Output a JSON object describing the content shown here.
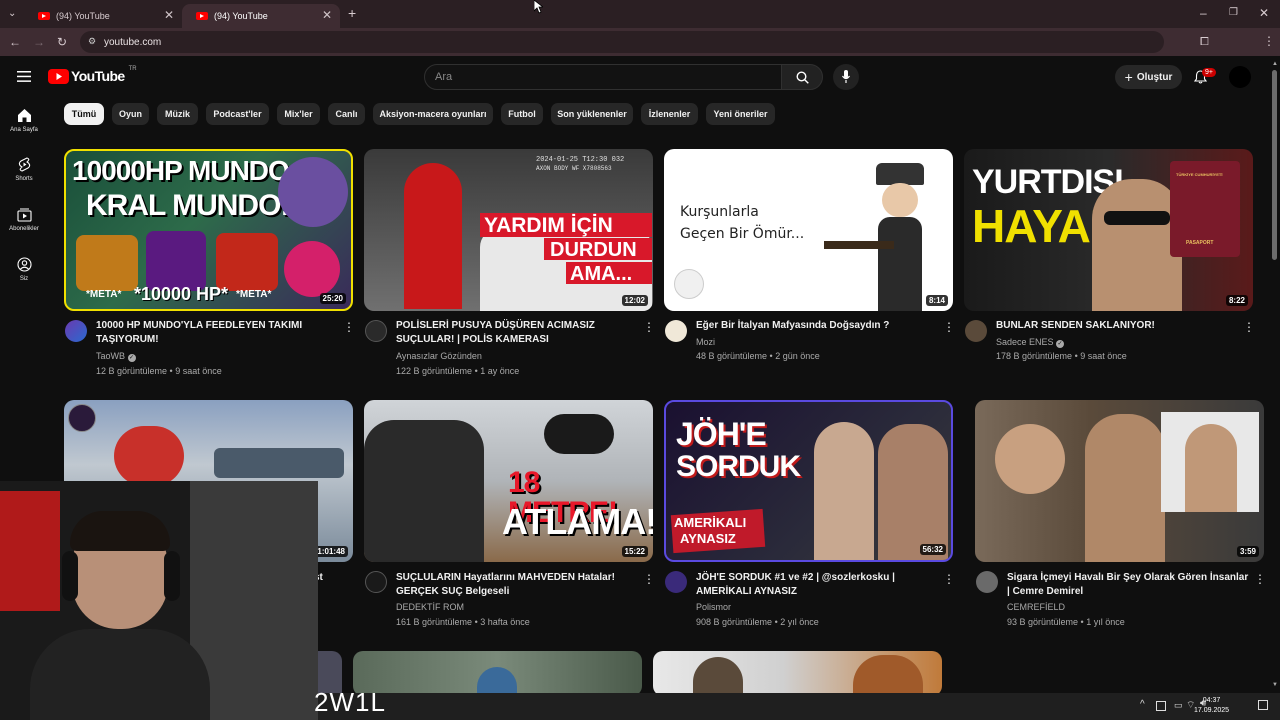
{
  "browser": {
    "tabs": [
      {
        "title": "(94) YouTube"
      },
      {
        "title": "(94) YouTube"
      }
    ],
    "new_tab": "+",
    "url": "youtube.com",
    "extension_badge": "19"
  },
  "masthead": {
    "logo_text": "YouTube",
    "logo_region": "TR",
    "search_placeholder": "Ara",
    "create_label": "Oluştur",
    "notifications_badge": "9+"
  },
  "sidebar": {
    "items": [
      {
        "label": "Ana Sayfa",
        "icon": "home-icon"
      },
      {
        "label": "Shorts",
        "icon": "shorts-icon"
      },
      {
        "label": "Abonelikler",
        "icon": "subscriptions-icon"
      },
      {
        "label": "Siz",
        "icon": "you-icon"
      }
    ]
  },
  "chips": [
    "Tümü",
    "Oyun",
    "Müzik",
    "Podcast'ler",
    "Mix'ler",
    "Canlı",
    "Aksiyon-macera oyunları",
    "Futbol",
    "Son yüklenenler",
    "İzlenenler",
    "Yeni öneriler"
  ],
  "videos": [
    {
      "title_line1": "10000 HP MUNDO'YLA FEEDLEYEN TAKIMI",
      "title_line2": "TAŞIYORUM!",
      "channel": "TaoWB",
      "verified": true,
      "views": "12 B görüntüleme",
      "age": "9 saat önce",
      "duration": "25:20",
      "thumb_text": [
        "10000HP MUNDO",
        "KRAL MUNDO!",
        "*META*",
        "*10000 HP*",
        "*META*"
      ]
    },
    {
      "title_line1": "POLİSLERİ PUSUYA DÜŞÜREN ACIMASIZ",
      "title_line2": "SUÇLULAR! | POLİS KAMERASI",
      "channel": "Aynasızlar Gözünden",
      "verified": false,
      "views": "122 B görüntüleme",
      "age": "1 ay önce",
      "duration": "12:02",
      "thumb_text": [
        "YARDIM İÇİN",
        "DURDUN",
        "AMA...",
        "2024-01-25 T12:30 032",
        "AXON BODY WF X7808563"
      ]
    },
    {
      "title_line1": "Eğer Bir İtalyan Mafyasında Doğsaydın ?",
      "title_line2": "",
      "channel": "Mozi",
      "verified": false,
      "views": "48 B görüntüleme",
      "age": "2 gün önce",
      "duration": "8:14",
      "thumb_text": [
        "Kurşunlarla",
        "Geçen Bir Ömür..."
      ]
    },
    {
      "title_line1": "BUNLAR SENDEN SAKLANIYOR!",
      "title_line2": "",
      "channel": "Sadece ENES",
      "verified": true,
      "views": "178 B görüntüleme",
      "age": "9 saat önce",
      "duration": "8:22",
      "thumb_text": [
        "YURTDIŞI",
        "HAYALİ",
        "TÜRKİYE CUMHURİYETİ",
        "PASAPORT"
      ]
    },
    {
      "title_line1": "",
      "title_line2": "",
      "title_visible_fragment": "st",
      "channel": "",
      "verified": false,
      "views": "",
      "age": "",
      "duration": "1:01:48",
      "thumb_text": []
    },
    {
      "title_line1": "SUÇLULARIN Hayatlarını MAHVEDEN Hatalar!",
      "title_line2": "GERÇEK SUÇ Belgeseli",
      "channel": "DEDEKTİF ROM",
      "verified": false,
      "views": "161 B görüntüleme",
      "age": "3 hafta önce",
      "duration": "15:22",
      "thumb_text": [
        "18 METRE!",
        "ATLAMA!"
      ]
    },
    {
      "title_line1": "JÖH'E SORDUK #1 ve #2 | @sozlerkosku |",
      "title_line2": "AMERİKALI AYNASIZ",
      "channel": "Polismor",
      "verified": false,
      "views": "908 B görüntüleme",
      "age": "2 yıl önce",
      "duration": "56:32",
      "thumb_text": [
        "JÖH'E",
        "SORDUK",
        "AMERİKALI",
        "AYNASIZ"
      ]
    },
    {
      "title_line1": "Sigara İçmeyi Havalı Bir Şey Olarak Gören İnsanlar",
      "title_line2": "| Cemre Demirel",
      "channel": "CEMREFİELD",
      "verified": false,
      "views": "93 B görüntüleme",
      "age": "1 yıl önce",
      "duration": "3:59",
      "thumb_text": []
    }
  ],
  "overlay": {
    "watermark": "2W1L"
  },
  "taskbar": {
    "time": "04:37",
    "date": "17.09.2025"
  },
  "colors": {
    "background": "#0f0f0f",
    "chip_bg": "#272727",
    "chip_active_bg": "#f1f1f1",
    "youtube_red": "#ff0000",
    "secondary_text": "#aaaaaa",
    "browser_frame": "#2b1f23"
  }
}
